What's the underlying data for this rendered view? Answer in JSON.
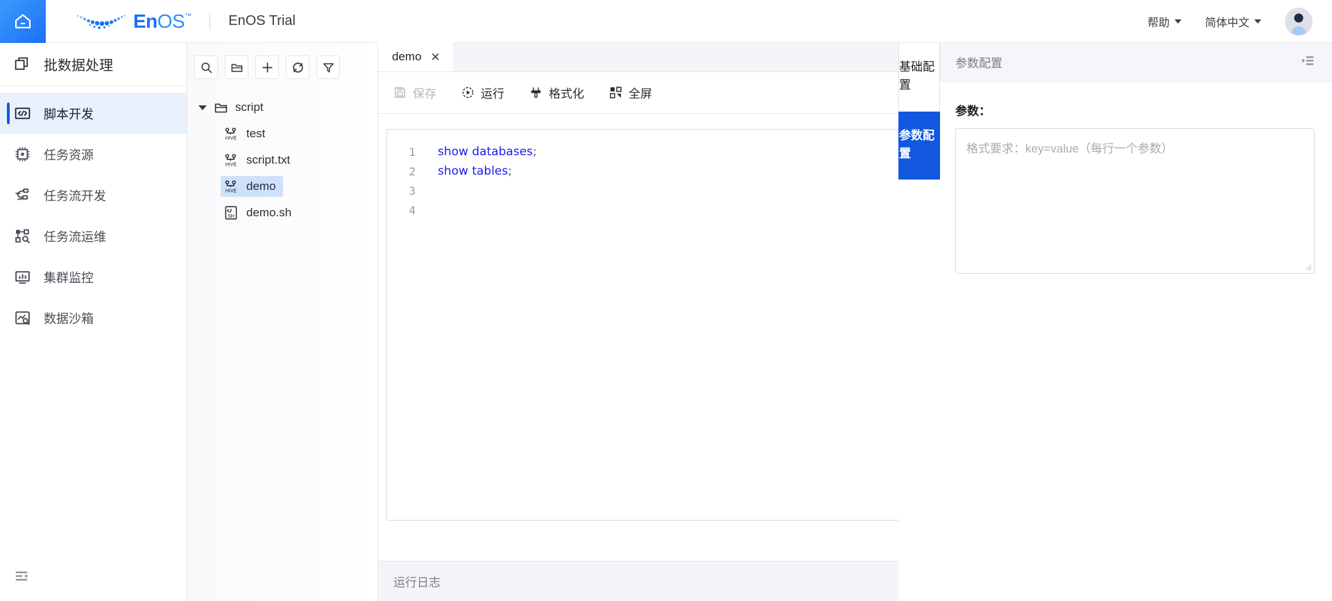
{
  "header": {
    "home_icon": "home-icon",
    "logo_en": "En",
    "logo_os": "OS",
    "logo_tm": "™",
    "brand_title": "EnOS Trial",
    "help_label": "帮助",
    "lang_label": "简体中文",
    "avatar_icon": "user-avatar-icon"
  },
  "sidebar": {
    "module_title": "批数据处理",
    "module_icon": "batch-data-icon",
    "collapse_icon": "menu-fold-icon",
    "items": [
      {
        "label": "脚本开发",
        "icon": "code-brackets-icon",
        "active": true
      },
      {
        "label": "任务资源",
        "icon": "cpu-chip-icon",
        "active": false
      },
      {
        "label": "任务流开发",
        "icon": "workflow-icon",
        "active": false
      },
      {
        "label": "任务流运维",
        "icon": "nodes-search-icon",
        "active": false
      },
      {
        "label": "集群监控",
        "icon": "monitor-chart-icon",
        "active": false
      },
      {
        "label": "数据沙箱",
        "icon": "image-search-icon",
        "active": false
      }
    ]
  },
  "filetree": {
    "toolbar": [
      {
        "name": "search-icon",
        "title": "搜索"
      },
      {
        "name": "new-folder-icon",
        "title": "新建文件夹"
      },
      {
        "name": "plus-icon",
        "title": "新建"
      },
      {
        "name": "refresh-icon",
        "title": "刷新"
      },
      {
        "name": "filter-icon",
        "title": "筛选"
      }
    ],
    "root": {
      "label": "script",
      "icon": "folder-icon",
      "expanded": true
    },
    "files": [
      {
        "label": "test",
        "icon": "hive-file-icon",
        "selected": false
      },
      {
        "label": "script.txt",
        "icon": "hive-file-icon",
        "selected": false
      },
      {
        "label": "demo",
        "icon": "hive-file-icon",
        "selected": true
      },
      {
        "label": "demo.sh",
        "icon": "sh-file-icon",
        "selected": false
      }
    ]
  },
  "editor": {
    "tab": {
      "label": "demo",
      "close_label": "✕"
    },
    "toolbar": [
      {
        "label": "保存",
        "icon": "save-icon",
        "disabled": true
      },
      {
        "label": "运行",
        "icon": "play-circle-icon",
        "disabled": false
      },
      {
        "label": "格式化",
        "icon": "format-brush-icon",
        "disabled": false
      },
      {
        "label": "全屏",
        "icon": "fullscreen-icon",
        "disabled": false
      }
    ],
    "code_lines": [
      {
        "n": "1",
        "text": "show databases",
        "semi": ";"
      },
      {
        "n": "2",
        "text": "show tables",
        "semi": ";"
      },
      {
        "n": "3",
        "text": "",
        "semi": ""
      },
      {
        "n": "4",
        "text": "",
        "semi": ""
      }
    ],
    "log_label": "运行日志"
  },
  "vtabs": [
    {
      "label": "基础配置",
      "active": false
    },
    {
      "label": "参数配置",
      "active": true
    }
  ],
  "rightpanel": {
    "title": "参数配置",
    "collapse_icon": "menu-unfold-icon",
    "param_label": "参数：",
    "param_value": "",
    "param_placeholder": "格式要求：key=value（每行一个参数）",
    "resize_handle_icon": "resize-handle-icon"
  },
  "colors": {
    "accent": "#1257e0",
    "logo_blue": "#1a73f0",
    "active_bg": "#e9f1fe",
    "selected_file_bg": "#cfe0fb",
    "code_keyword": "#1b1bf0"
  }
}
